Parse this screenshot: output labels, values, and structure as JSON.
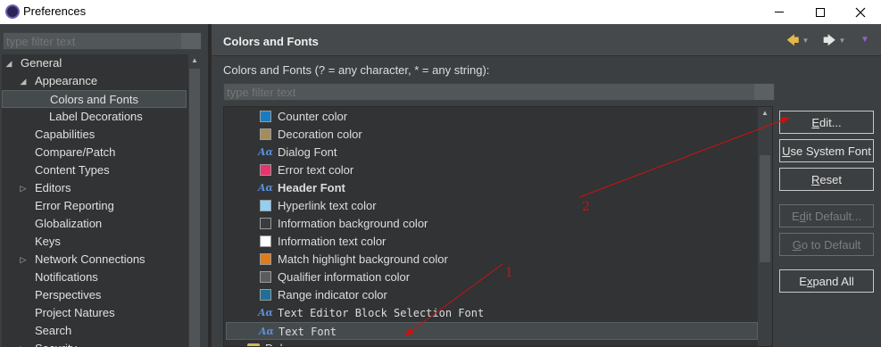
{
  "window": {
    "title": "Preferences",
    "icon": "eclipse-icon"
  },
  "left": {
    "filter_placeholder": "type filter text",
    "tree": [
      {
        "label": "General",
        "level": 0,
        "expander": "expanded"
      },
      {
        "label": "Appearance",
        "level": 1,
        "expander": "expanded"
      },
      {
        "label": "Colors and Fonts",
        "level": 2,
        "expander": "none",
        "selected": true
      },
      {
        "label": "Label Decorations",
        "level": 2,
        "expander": "none"
      },
      {
        "label": "Capabilities",
        "level": 1,
        "expander": "none"
      },
      {
        "label": "Compare/Patch",
        "level": 1,
        "expander": "none"
      },
      {
        "label": "Content Types",
        "level": 1,
        "expander": "none"
      },
      {
        "label": "Editors",
        "level": 1,
        "expander": "collapsed"
      },
      {
        "label": "Error Reporting",
        "level": 1,
        "expander": "none"
      },
      {
        "label": "Globalization",
        "level": 1,
        "expander": "none"
      },
      {
        "label": "Keys",
        "level": 1,
        "expander": "none"
      },
      {
        "label": "Network Connections",
        "level": 1,
        "expander": "collapsed"
      },
      {
        "label": "Notifications",
        "level": 1,
        "expander": "none"
      },
      {
        "label": "Perspectives",
        "level": 1,
        "expander": "none"
      },
      {
        "label": "Project Natures",
        "level": 1,
        "expander": "none"
      },
      {
        "label": "Search",
        "level": 1,
        "expander": "none"
      },
      {
        "label": "Security",
        "level": 1,
        "expander": "collapsed"
      }
    ]
  },
  "right": {
    "title": "Colors and Fonts",
    "description": "Colors and Fonts (? = any character, * = any string):",
    "filter_placeholder": "type filter text",
    "items": [
      {
        "label": "Counter color",
        "kind": "color",
        "color": "#1a7cc0"
      },
      {
        "label": "Decoration color",
        "kind": "color",
        "color": "#a38d5c"
      },
      {
        "label": "Dialog Font",
        "kind": "font"
      },
      {
        "label": "Error text color",
        "kind": "color",
        "color": "#e8336d"
      },
      {
        "label": "Header Font",
        "kind": "font",
        "bold": true
      },
      {
        "label": "Hyperlink text color",
        "kind": "color",
        "color": "#8fd0f7"
      },
      {
        "label": "Information background color",
        "kind": "color",
        "color": "#3a3d3f"
      },
      {
        "label": "Information text color",
        "kind": "color",
        "color": "#ffffff"
      },
      {
        "label": "Match highlight background color",
        "kind": "color",
        "color": "#e07b19"
      },
      {
        "label": "Qualifier information color",
        "kind": "color",
        "color": "#5a5d60"
      },
      {
        "label": "Range indicator color",
        "kind": "color",
        "color": "#1f6f99"
      },
      {
        "label": "Text Editor Block Selection Font",
        "kind": "font",
        "mono": true
      },
      {
        "label": "Text Font",
        "kind": "font",
        "mono": true,
        "selected": true
      },
      {
        "label": "Debug",
        "kind": "folder"
      }
    ],
    "buttons": {
      "edit": {
        "label": "Edit...",
        "mnemonic": "E",
        "rest": "dit...",
        "enabled": true
      },
      "use_system_font": {
        "label": "Use System Font",
        "mnemonic": "U",
        "rest": "se System Font",
        "enabled": true
      },
      "reset": {
        "label": "Reset",
        "mnemonic": "R",
        "rest": "eset",
        "enabled": true
      },
      "edit_default": {
        "label": "Edit Default...",
        "pre": "E",
        "mnemonic": "d",
        "rest": "it Default...",
        "enabled": false
      },
      "go_to_default": {
        "label": "Go to Default",
        "mnemonic": "G",
        "rest": "o to Default",
        "enabled": false
      },
      "expand_all": {
        "label": "Expand All",
        "pre": "E",
        "mnemonic": "x",
        "rest": "pand All",
        "enabled": true
      }
    }
  },
  "annotations": [
    {
      "label": "1",
      "color": "#cc1111"
    },
    {
      "label": "2",
      "color": "#cc1111"
    }
  ]
}
